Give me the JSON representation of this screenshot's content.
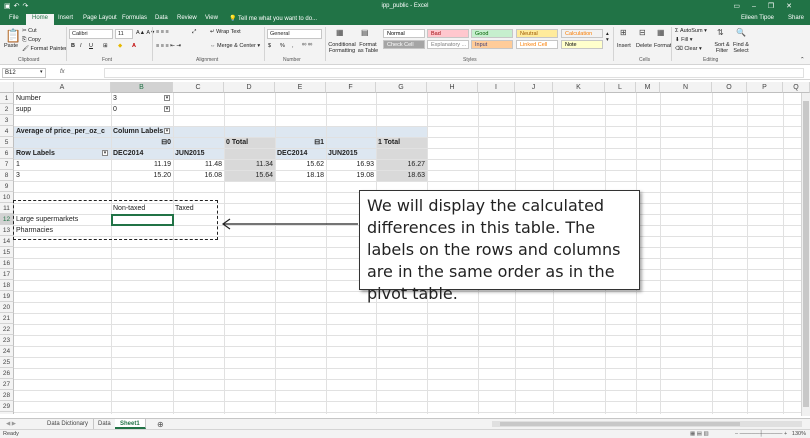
{
  "app": {
    "title": "ipp_public - Excel",
    "user": "Eileen Tipoe",
    "share": "Share",
    "tell_me": "Tell me what you want to do...",
    "qat_icons": [
      "save-icon",
      "undo-icon",
      "redo-icon"
    ],
    "window_controls": [
      "ribbon-display-icon",
      "minimize-icon",
      "restore-icon",
      "close-icon"
    ]
  },
  "ribbon_tabs": [
    "File",
    "Home",
    "Insert",
    "Page Layout",
    "Formulas",
    "Data",
    "Review",
    "View"
  ],
  "active_tab": "Home",
  "ribbon": {
    "clipboard": {
      "label": "Clipboard",
      "paste": "Paste",
      "cut": "Cut",
      "copy": "Copy",
      "format_painter": "Format Painter"
    },
    "font": {
      "label": "Font",
      "name": "Calibri",
      "size": "11",
      "bold": "B",
      "italic": "I",
      "underline": "U"
    },
    "alignment": {
      "label": "Alignment",
      "wrap": "Wrap Text",
      "merge": "Merge & Center"
    },
    "number": {
      "label": "Number",
      "format": "General",
      "currency": "$",
      "percent": "%",
      "comma": ","
    },
    "styles": {
      "label": "Styles",
      "conditional": "Conditional Formatting",
      "format_as_table": "Format as Table",
      "cells": [
        {
          "name": "Normal",
          "bg": "#ffffff",
          "fg": "#000000"
        },
        {
          "name": "Bad",
          "bg": "#ffc7ce",
          "fg": "#9c0006"
        },
        {
          "name": "Good",
          "bg": "#c6efce",
          "fg": "#006100"
        },
        {
          "name": "Neutral",
          "bg": "#ffeb9c",
          "fg": "#9c5700"
        },
        {
          "name": "Calculation",
          "bg": "#f2f2f2",
          "fg": "#fa7d00"
        },
        {
          "name": "Check Cell",
          "bg": "#a5a5a5",
          "fg": "#ffffff"
        },
        {
          "name": "Explanatory ...",
          "bg": "#ffffff",
          "fg": "#7f7f7f"
        },
        {
          "name": "Input",
          "bg": "#ffcc99",
          "fg": "#3f3f76"
        },
        {
          "name": "Linked Cell",
          "bg": "#ffffff",
          "fg": "#fa7d00"
        },
        {
          "name": "Note",
          "bg": "#ffffcc",
          "fg": "#000000"
        }
      ]
    },
    "cells": {
      "label": "Cells",
      "insert": "Insert",
      "delete": "Delete",
      "format": "Format"
    },
    "editing": {
      "label": "Editing",
      "autosum": "AutoSum",
      "fill": "Fill",
      "clear": "Clear",
      "sort": "Sort & Filter",
      "find": "Find & Select"
    }
  },
  "formula_bar": {
    "name_box": "B12",
    "fx": "fx",
    "value": ""
  },
  "columns": [
    "A",
    "B",
    "C",
    "D",
    "E",
    "F",
    "G",
    "H",
    "I",
    "J",
    "K",
    "L",
    "M",
    "N",
    "O",
    "P",
    "Q"
  ],
  "rows": [
    "1",
    "2",
    "3",
    "4",
    "5",
    "6",
    "7",
    "8",
    "9",
    "10",
    "11",
    "12",
    "13",
    "14",
    "15",
    "16",
    "17",
    "18",
    "19",
    "20",
    "21",
    "22",
    "23",
    "24",
    "25",
    "26",
    "27",
    "28",
    "29",
    "30"
  ],
  "cells": {
    "A1": "Number",
    "B1": "3",
    "A2": "supp",
    "B2": "0",
    "A4": "Average of price_per_oz_c",
    "B4": "Column Labels",
    "B5": "⊟0",
    "D5": "0 Total",
    "E5": "⊟1",
    "G5": "1 Total",
    "A6": "Row Labels",
    "B6": "DEC2014",
    "C6": "JUN2015",
    "E6": "DEC2014",
    "F6": "JUN2015",
    "A7": "1",
    "B7": "11.19",
    "C7": "11.48",
    "D7": "11.34",
    "E7": "15.62",
    "F7": "16.93",
    "G7": "16.27",
    "A8": "3",
    "B8": "15.20",
    "C8": "16.08",
    "D8": "15.64",
    "E8": "18.18",
    "F8": "19.08",
    "G8": "18.63",
    "B11": "Non-taxed",
    "C11": "Taxed",
    "A12": "Large supermarkets",
    "A13": "Pharmacies"
  },
  "callout": {
    "text": "We will display the calculated differences in this table. The labels on the rows and columns are in the same order as in the pivot table."
  },
  "sheets": [
    "Data Dictionary",
    "Data",
    "Sheet1"
  ],
  "active_sheet": "Sheet1",
  "status": {
    "ready": "Ready",
    "zoom": "130%"
  },
  "colors": {
    "excel_green": "#217346",
    "pivot_header": "#dde7f1",
    "pivot_total": "#d9d9d9"
  }
}
